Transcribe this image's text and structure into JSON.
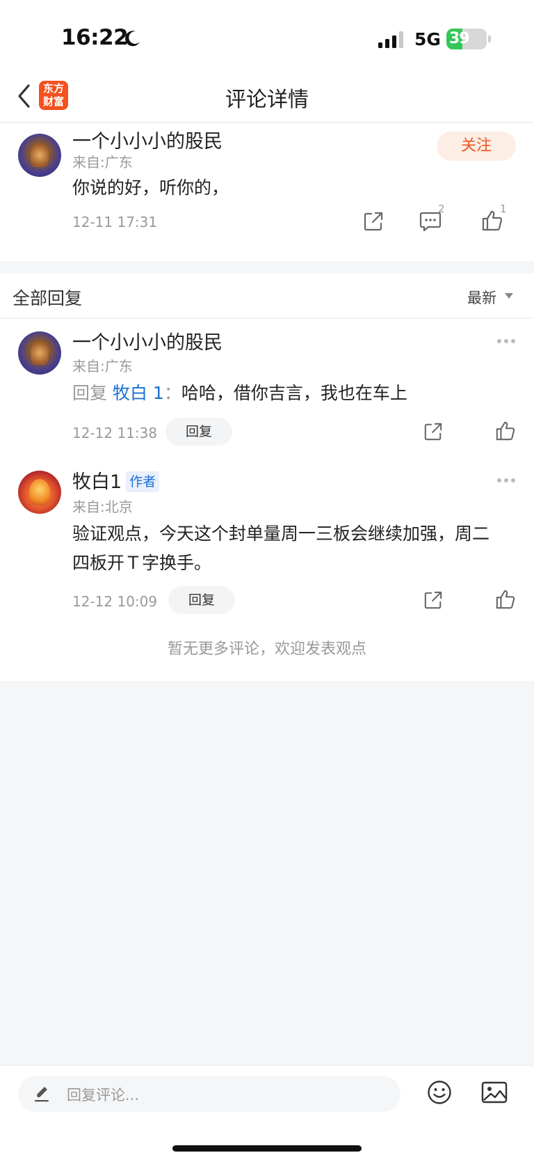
{
  "status_bar": {
    "time": "16:22",
    "network": "5G",
    "battery": "39",
    "battery_level": 0.39
  },
  "nav": {
    "title": "评论详情",
    "logo_line1": "东方",
    "logo_line2": "财富"
  },
  "main_comment": {
    "username": "一个小小小的股民",
    "location": "来自:广东",
    "text": "你说的好，听你的，",
    "timestamp": "12-11 17:31",
    "follow_label": "关注",
    "comment_count": "2",
    "like_count": "1"
  },
  "replies_header": {
    "title": "全部回复",
    "sort_label": "最新"
  },
  "replies": [
    {
      "username": "一个小小小的股民",
      "location": "来自:广东",
      "reply_prefix": "回复 ",
      "reply_target": "牧白 1",
      "reply_colon": "：",
      "text": "哈哈，借你吉言，我也在车上",
      "timestamp": "12-12 11:38",
      "reply_label": "回复"
    },
    {
      "username": "牧白1",
      "badge": "作者",
      "location": "来自:北京",
      "text_line1": "验证观点，今天这个封单量周一三板会继续加强，周二",
      "text_line2": "四板开Ｔ字换手。",
      "timestamp": "12-12 10:09",
      "reply_label": "回复"
    }
  ],
  "end_text": "暂无更多评论，欢迎发表观点",
  "bottom_bar": {
    "input_placeholder": "回复评论..."
  },
  "colors": {
    "accent_orange": "#f0541e",
    "link_blue": "#1a6fd1",
    "battery_green": "#34c759"
  }
}
